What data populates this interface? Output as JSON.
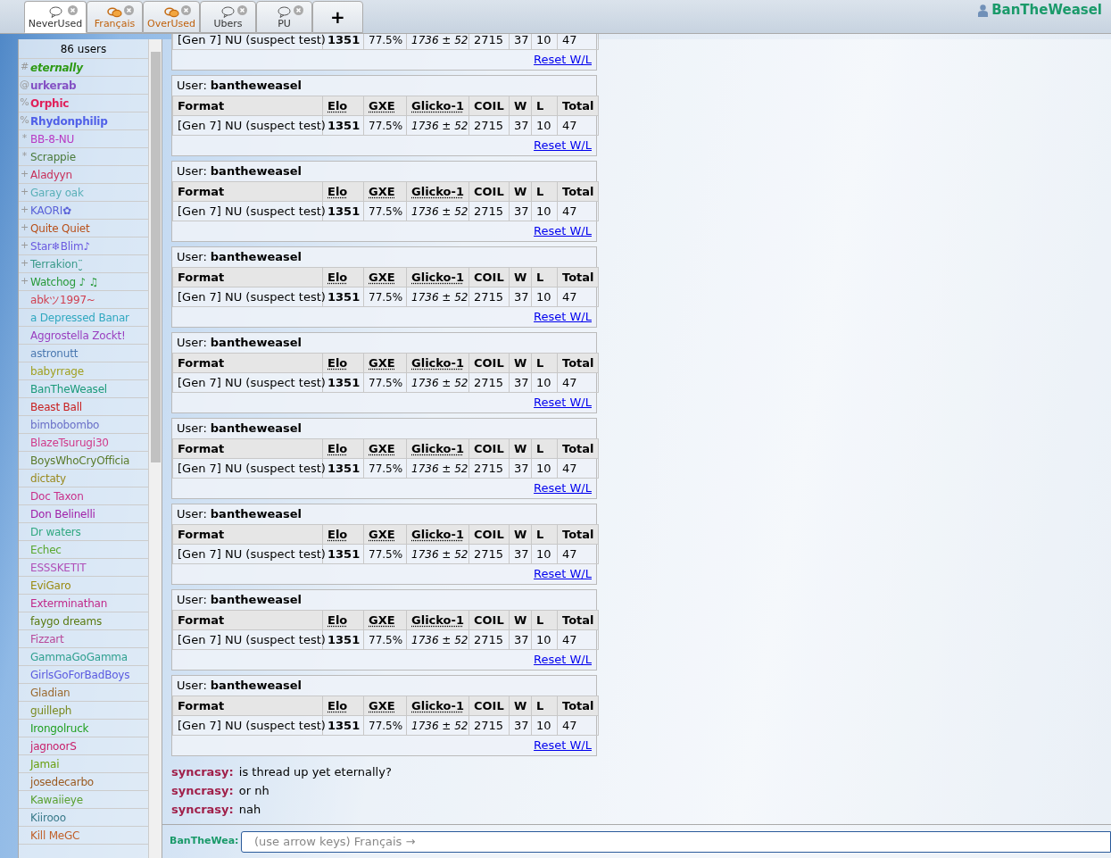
{
  "tabs": [
    {
      "label": "NeverUsed",
      "selected": true,
      "unread": false
    },
    {
      "label": "Français",
      "selected": false,
      "unread": true
    },
    {
      "label": "OverUsed",
      "selected": false,
      "unread": true
    },
    {
      "label": "Ubers",
      "selected": false,
      "unread": false
    },
    {
      "label": "PU",
      "selected": false,
      "unread": false
    }
  ],
  "new_tab_button": "+",
  "account": {
    "name": "BanTheWeasel"
  },
  "userlist": {
    "count": "86 users",
    "users": [
      {
        "rank": "#",
        "name": "eternally",
        "color": "#2e9a14",
        "bold": true,
        "italic": true
      },
      {
        "rank": "@",
        "name": "urkerab",
        "color": "#8451c4",
        "bold": true,
        "italic": false
      },
      {
        "rank": "%",
        "name": "Orphic",
        "color": "#e0205a",
        "bold": true,
        "italic": false
      },
      {
        "rank": "%",
        "name": "Rhydonphilip",
        "color": "#5060e8",
        "bold": true,
        "italic": false
      },
      {
        "rank": "*",
        "name": "BB-8-NU",
        "color": "#b83ac4",
        "bold": false,
        "italic": false
      },
      {
        "rank": "*",
        "name": "Scrappie",
        "color": "#4a7a3a",
        "bold": false,
        "italic": false
      },
      {
        "rank": "+",
        "name": "Aladyyn",
        "color": "#c8305a",
        "bold": false,
        "italic": false
      },
      {
        "rank": "+",
        "name": "Garay oak",
        "color": "#5ab0b8",
        "bold": false,
        "italic": false
      },
      {
        "rank": "+",
        "name": "KAORI✿",
        "color": "#5a62d8",
        "bold": false,
        "italic": false
      },
      {
        "rank": "+",
        "name": "Quite Quiet",
        "color": "#b8501a",
        "bold": false,
        "italic": false
      },
      {
        "rank": "+",
        "name": "Star❄Blim♪",
        "color": "#6a5ae0",
        "bold": false,
        "italic": false
      },
      {
        "rank": "+",
        "name": "Terrakion¨̮",
        "color": "#3a9a8a",
        "bold": false,
        "italic": false
      },
      {
        "rank": "+",
        "name": "Watchog ♪ ♫",
        "color": "#289a3a",
        "bold": false,
        "italic": false
      },
      {
        "name": "abkツ1997~",
        "color": "#d04050",
        "bold": false,
        "italic": false
      },
      {
        "name": "a Depressed Banar",
        "color": "#30a8c0",
        "bold": false,
        "italic": false
      },
      {
        "name": "Aggrostella Zockt!",
        "color": "#9a40c0",
        "bold": false,
        "italic": false
      },
      {
        "name": "astronutt",
        "color": "#4a78b0",
        "bold": false,
        "italic": false
      },
      {
        "name": "babyrrage",
        "color": "#a0a020",
        "bold": false,
        "italic": false
      },
      {
        "name": "BanTheWeasel",
        "color": "#1a9a7a",
        "bold": false,
        "italic": false
      },
      {
        "name": "Beast Ball",
        "color": "#c82020",
        "bold": false,
        "italic": false
      },
      {
        "name": "bimbobombo",
        "color": "#6a70c8",
        "bold": false,
        "italic": false
      },
      {
        "name": "BlazeTsurugi30",
        "color": "#d03a8a",
        "bold": false,
        "italic": false
      },
      {
        "name": "BoysWhoCryOfficia",
        "color": "#5a7a2a",
        "bold": false,
        "italic": false
      },
      {
        "name": "dictaty",
        "color": "#9a8a20",
        "bold": false,
        "italic": false
      },
      {
        "name": "Doc Taxon",
        "color": "#c8308a",
        "bold": false,
        "italic": false
      },
      {
        "name": "Don Belinelli",
        "color": "#a020a8",
        "bold": false,
        "italic": false
      },
      {
        "name": "Dr waters",
        "color": "#30a880",
        "bold": false,
        "italic": false
      },
      {
        "name": "Echec",
        "color": "#5aa830",
        "bold": false,
        "italic": false
      },
      {
        "name": "ESSSKETIT",
        "color": "#b050b8",
        "bold": false,
        "italic": false
      },
      {
        "name": "EviGaro",
        "color": "#9a8a10",
        "bold": false,
        "italic": false
      },
      {
        "name": "Exterminathan",
        "color": "#c02a8a",
        "bold": false,
        "italic": false
      },
      {
        "name": "faygo dreams",
        "color": "#5a7a10",
        "bold": false,
        "italic": false
      },
      {
        "name": "Fizzart",
        "color": "#b84a9a",
        "bold": false,
        "italic": false
      },
      {
        "name": "GammaGoGamma",
        "color": "#30a090",
        "bold": false,
        "italic": false
      },
      {
        "name": "GirlsGoForBadBoys",
        "color": "#5a5ae0",
        "bold": false,
        "italic": false
      },
      {
        "name": "Gladian",
        "color": "#9a6a30",
        "bold": false,
        "italic": false
      },
      {
        "name": "guilleph",
        "color": "#7a8a20",
        "bold": false,
        "italic": false
      },
      {
        "name": "Irongolruck",
        "color": "#20a020",
        "bold": false,
        "italic": false
      },
      {
        "name": "jagnoorS",
        "color": "#c8206a",
        "bold": false,
        "italic": false
      },
      {
        "name": "Jamai",
        "color": "#6aa010",
        "bold": false,
        "italic": false
      },
      {
        "name": "josedecarbo",
        "color": "#9a5a20",
        "bold": false,
        "italic": false
      },
      {
        "name": "Kawaiieye",
        "color": "#5aa030",
        "bold": false,
        "italic": false
      },
      {
        "name": "Kiirooo",
        "color": "#3a7a8a",
        "bold": false,
        "italic": false
      },
      {
        "name": "Kill MeGC",
        "color": "#c0602a",
        "bold": false,
        "italic": false
      }
    ]
  },
  "cards": [
    {
      "rows": [
        [
          "[Gen 7] NU (suspect test)",
          "1351",
          "77.5%",
          "1736 ± 52",
          "2715",
          "37",
          "10",
          "47"
        ]
      ],
      "action": "Reset W/L"
    },
    {
      "user_label": "User:",
      "user": "bantheweasel",
      "columns": [
        {
          "label": "Format",
          "abbr": false
        },
        {
          "label": "Elo",
          "abbr": true
        },
        {
          "label": "GXE",
          "abbr": true
        },
        {
          "label": "Glicko-1",
          "abbr": true
        },
        {
          "label": "COIL",
          "abbr": false
        },
        {
          "label": "W",
          "abbr": false
        },
        {
          "label": "L",
          "abbr": false
        },
        {
          "label": "Total",
          "abbr": false
        }
      ],
      "rows": [
        [
          "[Gen 7] NU (suspect test)",
          "1351",
          "77.5%",
          "1736 ± 52",
          "2715",
          "37",
          "10",
          "47"
        ]
      ],
      "action": "Reset W/L"
    },
    {
      "user_label": "User:",
      "user": "bantheweasel",
      "columns": [
        {
          "label": "Format",
          "abbr": false
        },
        {
          "label": "Elo",
          "abbr": true
        },
        {
          "label": "GXE",
          "abbr": true
        },
        {
          "label": "Glicko-1",
          "abbr": true
        },
        {
          "label": "COIL",
          "abbr": false
        },
        {
          "label": "W",
          "abbr": false
        },
        {
          "label": "L",
          "abbr": false
        },
        {
          "label": "Total",
          "abbr": false
        }
      ],
      "rows": [
        [
          "[Gen 7] NU (suspect test)",
          "1351",
          "77.5%",
          "1736 ± 52",
          "2715",
          "37",
          "10",
          "47"
        ]
      ],
      "action": "Reset W/L"
    },
    {
      "user_label": "User:",
      "user": "bantheweasel",
      "columns": [
        {
          "label": "Format",
          "abbr": false
        },
        {
          "label": "Elo",
          "abbr": true
        },
        {
          "label": "GXE",
          "abbr": true
        },
        {
          "label": "Glicko-1",
          "abbr": true
        },
        {
          "label": "COIL",
          "abbr": false
        },
        {
          "label": "W",
          "abbr": false
        },
        {
          "label": "L",
          "abbr": false
        },
        {
          "label": "Total",
          "abbr": false
        }
      ],
      "rows": [
        [
          "[Gen 7] NU (suspect test)",
          "1351",
          "77.5%",
          "1736 ± 52",
          "2715",
          "37",
          "10",
          "47"
        ]
      ],
      "action": "Reset W/L"
    },
    {
      "user_label": "User:",
      "user": "bantheweasel",
      "columns": [
        {
          "label": "Format",
          "abbr": false
        },
        {
          "label": "Elo",
          "abbr": true
        },
        {
          "label": "GXE",
          "abbr": true
        },
        {
          "label": "Glicko-1",
          "abbr": true
        },
        {
          "label": "COIL",
          "abbr": false
        },
        {
          "label": "W",
          "abbr": false
        },
        {
          "label": "L",
          "abbr": false
        },
        {
          "label": "Total",
          "abbr": false
        }
      ],
      "rows": [
        [
          "[Gen 7] NU (suspect test)",
          "1351",
          "77.5%",
          "1736 ± 52",
          "2715",
          "37",
          "10",
          "47"
        ]
      ],
      "action": "Reset W/L"
    },
    {
      "user_label": "User:",
      "user": "bantheweasel",
      "columns": [
        {
          "label": "Format",
          "abbr": false
        },
        {
          "label": "Elo",
          "abbr": true
        },
        {
          "label": "GXE",
          "abbr": true
        },
        {
          "label": "Glicko-1",
          "abbr": true
        },
        {
          "label": "COIL",
          "abbr": false
        },
        {
          "label": "W",
          "abbr": false
        },
        {
          "label": "L",
          "abbr": false
        },
        {
          "label": "Total",
          "abbr": false
        }
      ],
      "rows": [
        [
          "[Gen 7] NU (suspect test)",
          "1351",
          "77.5%",
          "1736 ± 52",
          "2715",
          "37",
          "10",
          "47"
        ]
      ],
      "action": "Reset W/L"
    },
    {
      "user_label": "User:",
      "user": "bantheweasel",
      "columns": [
        {
          "label": "Format",
          "abbr": false
        },
        {
          "label": "Elo",
          "abbr": true
        },
        {
          "label": "GXE",
          "abbr": true
        },
        {
          "label": "Glicko-1",
          "abbr": true
        },
        {
          "label": "COIL",
          "abbr": false
        },
        {
          "label": "W",
          "abbr": false
        },
        {
          "label": "L",
          "abbr": false
        },
        {
          "label": "Total",
          "abbr": false
        }
      ],
      "rows": [
        [
          "[Gen 7] NU (suspect test)",
          "1351",
          "77.5%",
          "1736 ± 52",
          "2715",
          "37",
          "10",
          "47"
        ]
      ],
      "action": "Reset W/L"
    },
    {
      "user_label": "User:",
      "user": "bantheweasel",
      "columns": [
        {
          "label": "Format",
          "abbr": false
        },
        {
          "label": "Elo",
          "abbr": true
        },
        {
          "label": "GXE",
          "abbr": true
        },
        {
          "label": "Glicko-1",
          "abbr": true
        },
        {
          "label": "COIL",
          "abbr": false
        },
        {
          "label": "W",
          "abbr": false
        },
        {
          "label": "L",
          "abbr": false
        },
        {
          "label": "Total",
          "abbr": false
        }
      ],
      "rows": [
        [
          "[Gen 7] NU (suspect test)",
          "1351",
          "77.5%",
          "1736 ± 52",
          "2715",
          "37",
          "10",
          "47"
        ]
      ],
      "action": "Reset W/L"
    },
    {
      "user_label": "User:",
      "user": "bantheweasel",
      "columns": [
        {
          "label": "Format",
          "abbr": false
        },
        {
          "label": "Elo",
          "abbr": true
        },
        {
          "label": "GXE",
          "abbr": true
        },
        {
          "label": "Glicko-1",
          "abbr": true
        },
        {
          "label": "COIL",
          "abbr": false
        },
        {
          "label": "W",
          "abbr": false
        },
        {
          "label": "L",
          "abbr": false
        },
        {
          "label": "Total",
          "abbr": false
        }
      ],
      "rows": [
        [
          "[Gen 7] NU (suspect test)",
          "1351",
          "77.5%",
          "1736 ± 52",
          "2715",
          "37",
          "10",
          "47"
        ]
      ],
      "action": "Reset W/L"
    }
  ],
  "messages": [
    {
      "user": "syncrasy:",
      "text": "is thread up yet eternally?",
      "color": "#a0204a"
    },
    {
      "user": "syncrasy:",
      "text": "or nh",
      "color": "#a0204a"
    },
    {
      "user": "syncrasy:",
      "text": "nah",
      "color": "#a0204a"
    }
  ],
  "composer": {
    "name": "BanTheWea:",
    "placeholder": "(use arrow keys) Français →"
  }
}
